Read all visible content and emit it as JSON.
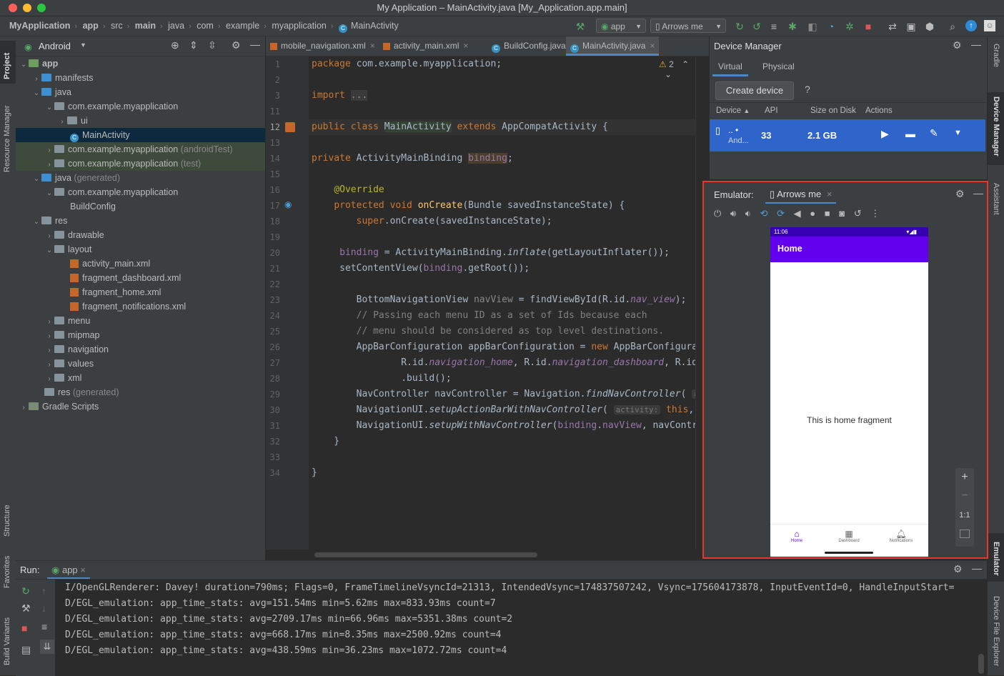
{
  "window": {
    "title": "My Application – MainActivity.java [My_Application.app.main]"
  },
  "breadcrumbs": [
    "MyApplication",
    "app",
    "src",
    "main",
    "java",
    "com",
    "example",
    "myapplication",
    "MainActivity"
  ],
  "toolbar": {
    "run_config": "app",
    "device": "Arrows me"
  },
  "left_strip": {
    "project": "Project",
    "resource_manager": "Resource Manager",
    "structure": "Structure",
    "favorites": "Favorites",
    "build_variants": "Build Variants"
  },
  "right_strip": {
    "gradle": "Gradle",
    "device_manager": "Device Manager",
    "assistant": "Assistant",
    "emulator": "Emulator",
    "device_file_explorer": "Device File Explorer"
  },
  "project_panel": {
    "view": "Android",
    "tree": [
      {
        "label": "app",
        "suffix": "",
        "bold": true
      },
      {
        "label": "manifests",
        "suffix": ""
      },
      {
        "label": "java",
        "suffix": ""
      },
      {
        "label": "com.example.myapplication",
        "suffix": ""
      },
      {
        "label": "ui",
        "suffix": ""
      },
      {
        "label": "MainActivity",
        "suffix": ""
      },
      {
        "label": "com.example.myapplication",
        "suffix": "(androidTest)"
      },
      {
        "label": "com.example.myapplication",
        "suffix": "(test)"
      },
      {
        "label": "java",
        "suffix": "(generated)"
      },
      {
        "label": "com.example.myapplication",
        "suffix": ""
      },
      {
        "label": "BuildConfig",
        "suffix": ""
      },
      {
        "label": "res",
        "suffix": ""
      },
      {
        "label": "drawable",
        "suffix": ""
      },
      {
        "label": "layout",
        "suffix": ""
      },
      {
        "label": "activity_main.xml",
        "suffix": ""
      },
      {
        "label": "fragment_dashboard.xml",
        "suffix": ""
      },
      {
        "label": "fragment_home.xml",
        "suffix": ""
      },
      {
        "label": "fragment_notifications.xml",
        "suffix": ""
      },
      {
        "label": "menu",
        "suffix": ""
      },
      {
        "label": "mipmap",
        "suffix": ""
      },
      {
        "label": "navigation",
        "suffix": ""
      },
      {
        "label": "values",
        "suffix": ""
      },
      {
        "label": "xml",
        "suffix": ""
      },
      {
        "label": "res",
        "suffix": "(generated)"
      },
      {
        "label": "Gradle Scripts",
        "suffix": ""
      }
    ]
  },
  "editor": {
    "tabs": [
      "mobile_navigation.xml",
      "activity_main.xml",
      "BuildConfig.java",
      "MainActivity.java"
    ],
    "warnings": "2",
    "line_numbers": [
      "1",
      "2",
      "3",
      "11",
      "12",
      "13",
      "14",
      "15",
      "16",
      "17",
      "18",
      "19",
      "20",
      "21",
      "22",
      "23",
      "24",
      "25",
      "26",
      "27",
      "28",
      "29",
      "30",
      "31",
      "32",
      "33",
      "34"
    ]
  },
  "device_manager": {
    "title": "Device Manager",
    "tabs": [
      "Virtual",
      "Physical"
    ],
    "create_button": "Create device",
    "help": "?",
    "columns": [
      "Device",
      "API",
      "Size on Disk",
      "Actions"
    ],
    "device": {
      "name": ".. •",
      "subtitle": "And...",
      "api": "33",
      "size": "2.1 GB"
    }
  },
  "emulator": {
    "label": "Emulator:",
    "tab": "Arrows me",
    "zoom_fit": "1:1",
    "phone": {
      "time": "11:06",
      "app_title": "Home",
      "content": "This is home fragment",
      "nav": [
        "Home",
        "Dashboard",
        "Notifications"
      ],
      "accent": "#6200ee"
    }
  },
  "run": {
    "label": "Run:",
    "tab": "app",
    "log": [
      "I/OpenGLRenderer: Davey! duration=790ms; Flags=0, FrameTimelineVsyncId=21313, IntendedVsync=174837507242, Vsync=175604173878, InputEventId=0, HandleInputStart=",
      "D/EGL_emulation: app_time_stats: avg=151.54ms min=5.62ms max=833.93ms count=7",
      "D/EGL_emulation: app_time_stats: avg=2709.17ms min=66.96ms max=5351.38ms count=2",
      "D/EGL_emulation: app_time_stats: avg=668.17ms min=8.35ms max=2500.92ms count=4",
      "D/EGL_emulation: app_time_stats: avg=438.59ms min=36.23ms max=1072.72ms count=4"
    ]
  },
  "colors": {
    "selection": "#0d293e",
    "device_row": "#2f65ca",
    "emulator_border": "#e8372a",
    "phone_accent": "#6200ee"
  }
}
